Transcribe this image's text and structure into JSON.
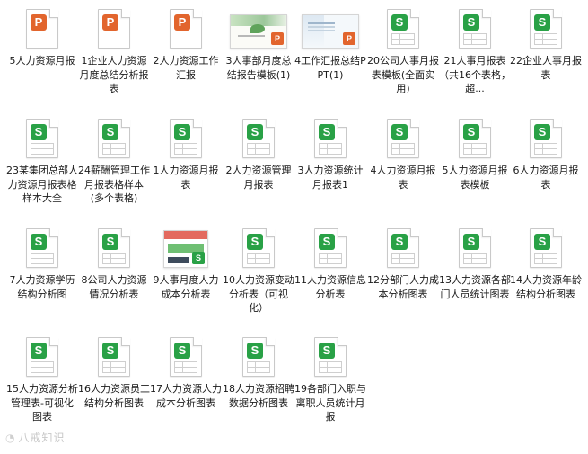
{
  "files": [
    {
      "label": "5人力资源月报",
      "icon": "ppt"
    },
    {
      "label": "1企业人力资源月度总结分析报表",
      "icon": "ppt"
    },
    {
      "label": "2人力资源工作汇报",
      "icon": "ppt"
    },
    {
      "label": "3人事部月度总结报告模板(1)",
      "icon": "thumb-green"
    },
    {
      "label": "4工作汇报总结PPT(1)",
      "icon": "thumb-blue"
    },
    {
      "label": "20公司人事月报表模板(全面实用)",
      "icon": "sheet"
    },
    {
      "label": "21人事月报表（共16个表格，超...",
      "icon": "sheet"
    },
    {
      "label": "22企业人事月报表",
      "icon": "sheet"
    },
    {
      "label": "23某集团总部人力资源月报表格样本大全",
      "icon": "sheet"
    },
    {
      "label": "24薪酬管理工作月报表格样本(多个表格)",
      "icon": "sheet"
    },
    {
      "label": "1人力资源月报表",
      "icon": "sheet"
    },
    {
      "label": "2人力资源管理月报表",
      "icon": "sheet"
    },
    {
      "label": "3人力资源统计月报表1",
      "icon": "sheet"
    },
    {
      "label": "4人力资源月报表",
      "icon": "sheet"
    },
    {
      "label": "5人力资源月报表模板",
      "icon": "sheet"
    },
    {
      "label": "6人力资源月报表",
      "icon": "sheet"
    },
    {
      "label": "7人力资源学历结构分析图",
      "icon": "sheet"
    },
    {
      "label": "8公司人力资源情况分析表",
      "icon": "sheet"
    },
    {
      "label": "9人事月度人力成本分析表",
      "icon": "thumb-sheet"
    },
    {
      "label": "10人力资源变动分析表（可视化）",
      "icon": "sheet"
    },
    {
      "label": "11人力资源信息分析表",
      "icon": "sheet"
    },
    {
      "label": "12分部门人力成本分析图表",
      "icon": "sheet"
    },
    {
      "label": "13人力资源各部门人员统计图表",
      "icon": "sheet"
    },
    {
      "label": "14人力资源年龄结构分析图表",
      "icon": "sheet"
    },
    {
      "label": "15人力资源分析管理表-可视化图表",
      "icon": "sheet"
    },
    {
      "label": "16人力资源员工结构分析图表",
      "icon": "sheet"
    },
    {
      "label": "17人力资源人力成本分析图表",
      "icon": "sheet"
    },
    {
      "label": "18人力资源招聘数据分析图表",
      "icon": "sheet"
    },
    {
      "label": "19各部门入职与离职人员统计月报",
      "icon": "sheet"
    }
  ],
  "watermark": "八戒知识"
}
